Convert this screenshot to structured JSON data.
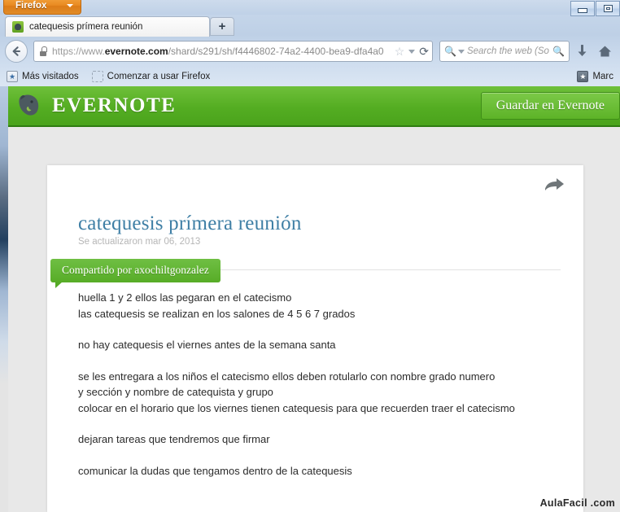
{
  "browser": {
    "app_menu_label": "Firefox",
    "window_controls": {
      "minimize": "Minimize",
      "restore": "Restore"
    },
    "tabs": [
      {
        "title": "catequesis prímera reunión",
        "favicon": "evernote-favicon",
        "active": true
      }
    ],
    "new_tab_label": "+",
    "back_button": "back-arrow-icon",
    "url": {
      "protocol": "https://www.",
      "domain": "evernote.com",
      "path": "/shard/s291/sh/f4446802-74a2-4400-bea9-dfa4a0",
      "full": "https://www.evernote.com/shard/s291/sh/f4446802-74a2-4400-bea9-dfa4a0",
      "security": "secure-lock-icon",
      "bookmark_star": "☆",
      "reload": "⟳"
    },
    "search": {
      "placeholder": "Search the web (So",
      "icon": "magnifier-icon",
      "go_icon": "magnifier-icon"
    },
    "toolbar_icons": [
      {
        "name": "downloads-icon",
        "glyph": "⬇"
      },
      {
        "name": "home-icon",
        "glyph": "⌂"
      }
    ],
    "bookmarks_bar": [
      {
        "label": "Más visitados",
        "icon": "most-visited-icon"
      },
      {
        "label": "Comenzar a usar Firefox",
        "icon": "dashed-folder-icon"
      }
    ],
    "bookmarks_right": {
      "label": "Marc",
      "icon": "bookmarks-star-icon"
    }
  },
  "evernote": {
    "brand": "EVERNOTE",
    "logo_icon": "evernote-elephant-icon",
    "save_button": "Guardar en Evernote",
    "share_icon": "share-arrow-icon",
    "shared_badge": "Compartido por axochiltgonzalez",
    "note": {
      "title": "catequesis prímera reunión",
      "updated": "Se actualizaron mar 06, 2013",
      "paragraphs": [
        "huella 1 y 2 ellos las pegaran en el catecismo\nlas catequesis se realizan en los salones de 4 5 6 7 grados",
        "no hay catequesis el viernes antes de la semana santa",
        "se les entregara a los niños el catecismo ellos deben rotularlo con nombre grado numero\ny  sección y nombre de catequista y grupo\ncolocar en el horario que los viernes tienen catequesis para que recuerden traer el catecismo",
        "dejaran tareas que tendremos que firmar",
        "comunicar la dudas que tengamos dentro de la catequesis"
      ]
    }
  },
  "watermark": "AulaFacil .com",
  "colors": {
    "evernote_green": "#54ad22",
    "evernote_green_dark": "#2f7d12",
    "note_title_blue": "#3f7fa5",
    "firefox_orange": "#e98a22",
    "page_bg": "#e8e8e8"
  }
}
